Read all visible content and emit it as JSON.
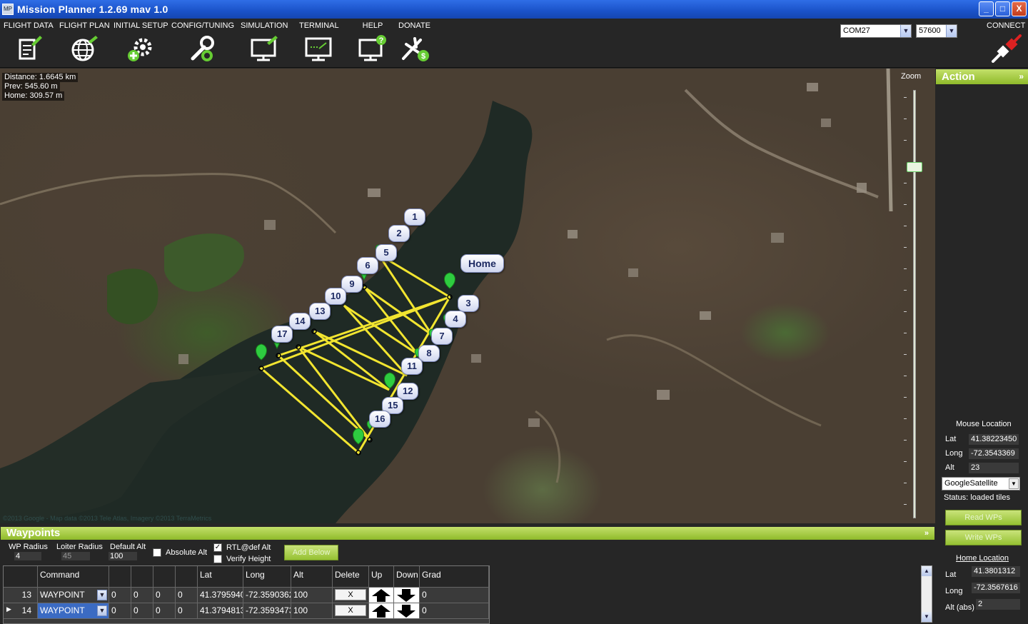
{
  "window": {
    "title": "Mission Planner 1.2.69 mav 1.0",
    "minimize": "_",
    "maximize": "□",
    "close": "X",
    "app_icon": "MP"
  },
  "toolbar": {
    "items": [
      {
        "label": "FLIGHT DATA",
        "icon": "flight-data-icon"
      },
      {
        "label": "FLIGHT PLAN",
        "icon": "flight-plan-icon"
      },
      {
        "label": "INITIAL SETUP",
        "icon": "initial-setup-icon"
      },
      {
        "label": "CONFIG/TUNING",
        "icon": "config-tuning-icon"
      },
      {
        "label": "SIMULATION",
        "icon": "simulation-icon"
      },
      {
        "label": "TERMINAL",
        "icon": "terminal-icon"
      },
      {
        "label": "HELP",
        "icon": "help-icon"
      },
      {
        "label": "DONATE",
        "icon": "donate-icon"
      }
    ],
    "com_port": "COM27",
    "baud_rate": "57600",
    "connect_label": "CONNECT"
  },
  "map": {
    "distance": "Distance: 1.6645 km",
    "prev": "Prev: 545.60 m",
    "home": "Home: 309.57 m",
    "zoom_label": "Zoom",
    "zoom_level_percent": 18,
    "copyright": "©2013 Google - Map data ©2013 Tele Atlas, Imagery ©2013 TerraMetrics",
    "home_label": "Home",
    "waypoint_labels": [
      "1",
      "2",
      "3",
      "4",
      "5",
      "6",
      "7",
      "8",
      "9",
      "10",
      "11",
      "12",
      "13",
      "14",
      "15",
      "16",
      "17"
    ]
  },
  "action_panel": {
    "title": "Action",
    "collapse_icon": "»",
    "mouse_location_title": "Mouse Location",
    "lat_label": "Lat",
    "lat": "41.38223450",
    "long_label": "Long",
    "long": "-72.3543369",
    "alt_label": "Alt",
    "alt": "23",
    "map_type": "GoogleSatellite",
    "status": "Status: loaded tiles",
    "read_wps": "Read WPs",
    "write_wps": "Write WPs",
    "home_location_title": "Home Location",
    "home_lat": "41.3801312",
    "home_long": "-72.3567616",
    "home_alt_label": "Alt (abs)",
    "home_alt": "2"
  },
  "waypoints_panel": {
    "title": "Waypoints",
    "collapse_icon": "»",
    "wp_radius_label": "WP Radius",
    "wp_radius": "4",
    "loiter_radius_label": "Loiter Radius",
    "loiter_radius": "45",
    "default_alt_label": "Default Alt",
    "default_alt": "100",
    "absolute_alt_label": "Absolute Alt",
    "rtl_def_alt_label": "RTL@def Alt",
    "verify_height_label": "Verify Height",
    "add_below": "Add Below",
    "columns": [
      "",
      "Command",
      "",
      "",
      "",
      "",
      "Lat",
      "Long",
      "Alt",
      "Delete",
      "Up",
      "Down",
      "Grad"
    ],
    "rows": [
      {
        "num": "13",
        "command": "WAYPOINT",
        "p1": "0",
        "p2": "0",
        "p3": "0",
        "p4": "0",
        "lat": "41.3795940",
        "long": "-72.3590362",
        "alt": "100",
        "delete": "X",
        "grad": "0",
        "selected": false
      },
      {
        "num": "14",
        "command": "WAYPOINT",
        "p1": "0",
        "p2": "0",
        "p3": "0",
        "p4": "0",
        "lat": "41.3794813",
        "long": "-72.3593473",
        "alt": "100",
        "delete": "X",
        "grad": "0",
        "selected": true
      }
    ]
  }
}
